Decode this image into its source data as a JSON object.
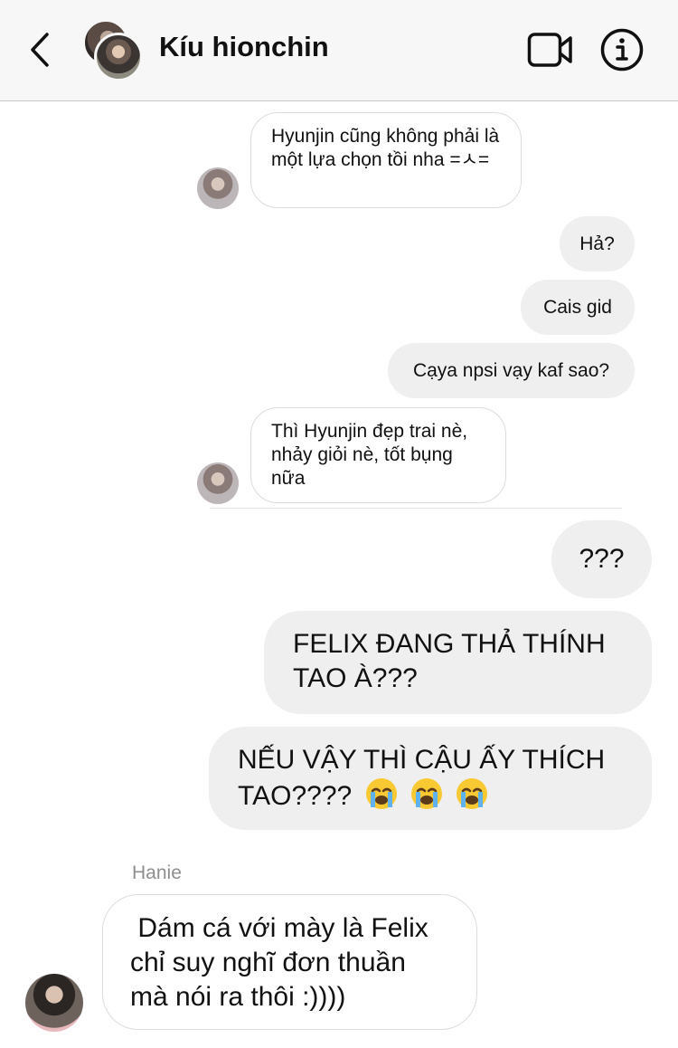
{
  "header": {
    "title": "Kíu hionchin"
  },
  "messages": {
    "m1": "Hyunjin cũng không phải là một lựa chọn tồi nha =ㅅ=",
    "m2": "Hả?",
    "m3": "Cais gid",
    "m4": "Cạya npsi vạy kaf sao?",
    "m5": "Thì Hyunjin đẹp trai nè, nhảy giỏi nè, tốt bụng nữa",
    "m6": "???",
    "m7": "FELIX ĐANG THẢ THÍNH TAO À???",
    "m8": "NẾU VẬY THÌ CẬU ẤY THÍCH TAO????",
    "m9_sender": "Hanie",
    "m9": " Dám cá với mày là Felix chỉ suy nghĩ đơn thuần mà nói ra thôi :))))"
  },
  "icons": {
    "back": "chevron-left-icon",
    "video": "video-camera-icon",
    "info": "info-icon",
    "emoji": "loudly-crying-face-emoji"
  },
  "colors": {
    "header_bg": "#f7f7f7",
    "outgoing_bubble": "#efefef",
    "incoming_bubble_border": "#dcdcdc",
    "sender_name": "#8e8e8e"
  }
}
